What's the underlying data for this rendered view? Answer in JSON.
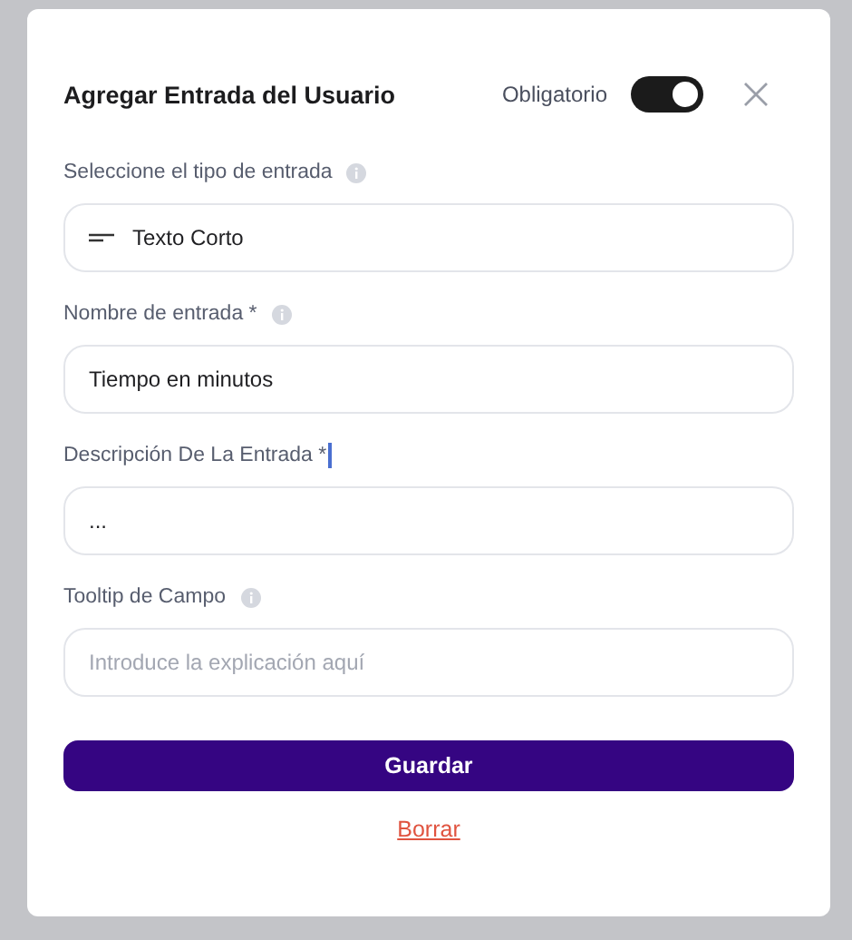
{
  "dialog": {
    "title": "Agregar Entrada del Usuario",
    "required_toggle": {
      "label": "Obligatorio",
      "on": true
    }
  },
  "fields": [
    {
      "kind": "select",
      "label": "Seleccione el tipo de entrada",
      "info": true,
      "cursor": false,
      "value": "Texto Corto"
    },
    {
      "kind": "text",
      "label": "Nombre de entrada *",
      "info": true,
      "cursor": false,
      "value": "Tiempo en minutos"
    },
    {
      "kind": "text",
      "label": "Descripción De La Entrada *",
      "info": false,
      "cursor": true,
      "value": "..."
    },
    {
      "kind": "text",
      "label": "Tooltip de Campo",
      "info": true,
      "cursor": false,
      "placeholder": "Introduce la explicación aquí"
    }
  ],
  "save_button": "Guardar",
  "clear_link": "Borrar"
}
